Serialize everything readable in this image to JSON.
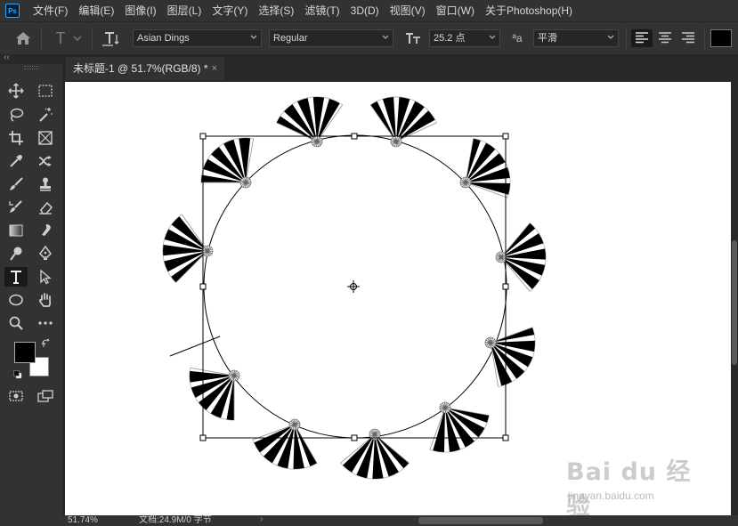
{
  "app": {
    "logo_text": "Ps",
    "menu": [
      "文件(F)",
      "编辑(E)",
      "图像(I)",
      "图层(L)",
      "文字(Y)",
      "选择(S)",
      "滤镜(T)",
      "3D(D)",
      "视图(V)",
      "窗口(W)",
      "关于Photoshop(H)"
    ]
  },
  "options_bar": {
    "font_family": "Asian Dings",
    "font_style": "Regular",
    "font_size": "25.2 点",
    "anti_alias_label": "ªa",
    "anti_alias": "平滑",
    "text_color": "#000000",
    "icons": [
      "home-icon",
      "text-tool-preset-icon",
      "text-orientation-icon",
      "font-size-icon",
      "align-left-icon",
      "align-center-icon",
      "align-right-icon"
    ]
  },
  "collapse_strip": {
    "label": "‹‹"
  },
  "document": {
    "tab_title": "未标题-1 @ 51.7%(RGB/8) *",
    "tab_close": "×"
  },
  "tools": {
    "foreground_color": "#000000",
    "background_color": "#ffffff",
    "active_tool": "type-tool",
    "items": [
      "move-tool",
      "marquee-tool",
      "lasso-tool",
      "magic-wand-tool",
      "crop-tool",
      "frame-tool",
      "eyedropper-tool",
      "patch-tool",
      "brush-tool",
      "stamp-tool",
      "history-brush-tool",
      "eraser-tool",
      "gradient-tool",
      "smudge-tool",
      "dodge-tool",
      "pen-tool",
      "type-tool",
      "path-select-tool",
      "ellipse-tool",
      "hand-tool",
      "zoom-tool",
      "more-tools",
      "quick-mask",
      "screen-mode"
    ]
  },
  "status_bar": {
    "zoom": "51.74%",
    "doc_size": "文档:24.9M/0 字节",
    "arrow": "›"
  },
  "watermark": {
    "logo_text": "Bai  du 经验",
    "url": "jingyan.baidu.com"
  }
}
